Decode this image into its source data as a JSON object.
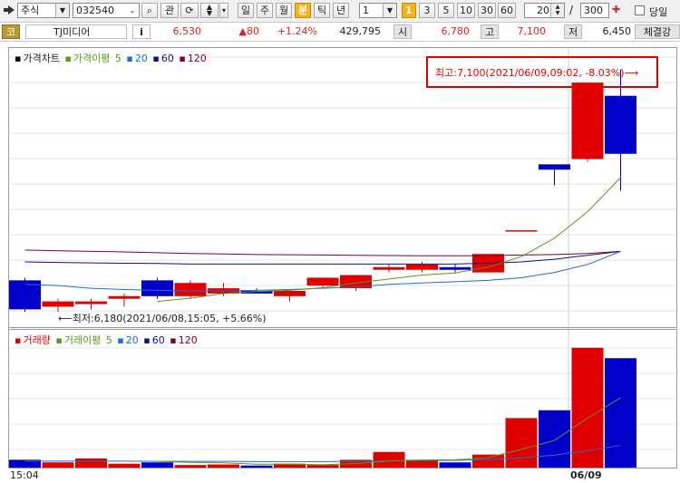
{
  "toolbar": {
    "market": "주식",
    "code": "032540",
    "btn_gwan": "관",
    "periods": [
      "일",
      "주",
      "월",
      "분",
      "틱",
      "년"
    ],
    "active_period": "분",
    "interval_value": "1",
    "interval_options": [
      "1",
      "3",
      "5",
      "10",
      "30",
      "60"
    ],
    "active_interval": "1",
    "count_value": "20",
    "slash": "/",
    "total_value": "300",
    "today_label": "당일"
  },
  "info": {
    "label_code": "코",
    "name": "TJ미디어",
    "info_btn": "i",
    "price": "6,530",
    "change": "▲80",
    "change_pct": "+1.24%",
    "volume": "429,795",
    "open_label": "시",
    "open": "6,780",
    "high_label": "고",
    "high": "7,100",
    "low_label": "저",
    "low": "6,450",
    "exec_label": "체결강"
  },
  "price_legend": {
    "title": "가격차트",
    "ma_title": "가격이평",
    "ma_periods": [
      "5",
      "20",
      "60",
      "120"
    ]
  },
  "volume_legend": {
    "title": "거래량",
    "ma_title": "거래이평",
    "ma_periods": [
      "5",
      "20",
      "60",
      "120"
    ]
  },
  "annotations": {
    "high": "최고:7,100(2021/06/09,09:02, -8.03%)⟶",
    "low": "⟵최저:6,180(2021/06/08,15:05, +5.66%)"
  },
  "axis": {
    "left_time": "15:04",
    "date_label": "06/09"
  },
  "colors": {
    "up": "#e00000",
    "down": "#0000c8",
    "ma5": "#5a9a1a",
    "ma20": "#1a70d0",
    "ma60": "#10108a",
    "ma120": "#800020"
  },
  "chart_data": {
    "type": "candlestick",
    "candles": [
      {
        "o": 6300,
        "h": 6310,
        "l": 6180,
        "c": 6190
      },
      {
        "o": 6200,
        "h": 6230,
        "l": 6180,
        "c": 6220
      },
      {
        "o": 6210,
        "h": 6230,
        "l": 6190,
        "c": 6220
      },
      {
        "o": 6230,
        "h": 6250,
        "l": 6200,
        "c": 6240
      },
      {
        "o": 6300,
        "h": 6310,
        "l": 6230,
        "c": 6240
      },
      {
        "o": 6240,
        "h": 6300,
        "l": 6230,
        "c": 6290
      },
      {
        "o": 6250,
        "h": 6290,
        "l": 6240,
        "c": 6270
      },
      {
        "o": 6260,
        "h": 6270,
        "l": 6250,
        "c": 6250
      },
      {
        "o": 6240,
        "h": 6260,
        "l": 6220,
        "c": 6260
      },
      {
        "o": 6280,
        "h": 6310,
        "l": 6270,
        "c": 6310
      },
      {
        "o": 6270,
        "h": 6320,
        "l": 6260,
        "c": 6320
      },
      {
        "o": 6340,
        "h": 6360,
        "l": 6330,
        "c": 6350
      },
      {
        "o": 6340,
        "h": 6370,
        "l": 6330,
        "c": 6360
      },
      {
        "o": 6350,
        "h": 6360,
        "l": 6330,
        "c": 6340
      },
      {
        "o": 6330,
        "h": 6400,
        "l": 6330,
        "c": 6400
      },
      {
        "o": 6490,
        "h": 6490,
        "l": 6490,
        "c": 6490
      },
      {
        "o": 6740,
        "h": 6740,
        "l": 6660,
        "c": 6720
      },
      {
        "o": 6760,
        "h": 7050,
        "l": 6750,
        "c": 7050
      },
      {
        "o": 7000,
        "h": 7100,
        "l": 6640,
        "c": 6780
      }
    ],
    "ma5": [
      null,
      null,
      null,
      null,
      6220,
      6232,
      6250,
      6258,
      6262,
      6272,
      6290,
      6305,
      6320,
      6328,
      6350,
      6390,
      6460,
      6560,
      6690
    ],
    "ma20": [
      6285,
      6280,
      6270,
      6265,
      6262,
      6260,
      6260,
      6262,
      6265,
      6270,
      6275,
      6285,
      6290,
      6295,
      6300,
      6310,
      6330,
      6360,
      6410
    ],
    "ma60": [
      6370,
      6368,
      6366,
      6365,
      6364,
      6362,
      6362,
      6362,
      6362,
      6362,
      6362,
      6362,
      6362,
      6362,
      6365,
      6370,
      6380,
      6395,
      6410
    ],
    "ma120": [
      6415,
      6412,
      6410,
      6408,
      6405,
      6402,
      6400,
      6398,
      6397,
      6396,
      6395,
      6394,
      6393,
      6393,
      6394,
      6396,
      6398,
      6402,
      6410
    ],
    "volumes": [
      300,
      200,
      350,
      150,
      200,
      100,
      120,
      80,
      150,
      100,
      300,
      600,
      300,
      200,
      500,
      1900,
      2200,
      4600,
      4200
    ],
    "vol_ma5": [
      null,
      null,
      null,
      null,
      240,
      200,
      184,
      130,
      130,
      110,
      154,
      246,
      290,
      300,
      380,
      700,
      1040,
      1900,
      2680
    ],
    "vol_ma20": [
      250,
      250,
      250,
      250,
      240,
      240,
      240,
      230,
      230,
      230,
      240,
      260,
      270,
      280,
      300,
      380,
      480,
      650,
      850
    ],
    "ylim": [
      6150,
      7140
    ],
    "vol_ylim": [
      0,
      4800
    ]
  }
}
